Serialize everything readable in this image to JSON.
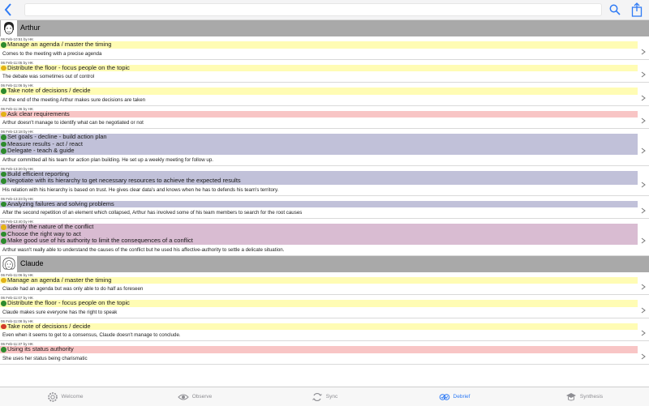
{
  "search": {
    "placeholder": "",
    "value": ""
  },
  "icons": {
    "back": "chevron-left-icon",
    "search": "search-icon",
    "share": "share-icon"
  },
  "colors": {
    "accent": "#2f7bf5",
    "yellow": "#fffcb4",
    "red": "#f8c5c5",
    "lavender": "#c1c1d9",
    "purple": "#d9bcd2",
    "status_ok": "#2e8b2e",
    "status_mid": "#e3b317",
    "status_bad": "#d23a2a"
  },
  "people": [
    {
      "name": "Arthur",
      "entries": [
        {
          "meta": "06 Feb-10:51 by HK",
          "color": "yellow",
          "criteria": [
            {
              "status": "ok",
              "label": "Manage an agenda / master the timing"
            }
          ],
          "comment": "Comes to the meeting with a precise agenda"
        },
        {
          "meta": "06 Feb-11:05 by HK",
          "color": "yellow",
          "criteria": [
            {
              "status": "mid",
              "label": "Distribute the floor - focus people on the topic"
            }
          ],
          "comment": "The debate was sometimes out of control"
        },
        {
          "meta": "06 Feb-11:06 by HK",
          "color": "yellow",
          "criteria": [
            {
              "status": "ok",
              "label": "Take note of decisions / decide"
            }
          ],
          "comment": "At the end of the meeting Arthur makes sure decisions are taken"
        },
        {
          "meta": "06 Feb-11:36 by HK",
          "color": "red",
          "criteria": [
            {
              "status": "mid",
              "label": "Ask clear requirements"
            }
          ],
          "comment": "Arthur doesn't manage to identify what can be negotiated or not"
        },
        {
          "meta": "06 Feb-13:18 by HK",
          "color": "lav",
          "criteria": [
            {
              "status": "ok",
              "label": "Set goals - decline - build action plan"
            },
            {
              "status": "ok",
              "label": "Measure results - act / react"
            },
            {
              "status": "ok",
              "label": "Delegate - teach & guide"
            }
          ],
          "comment": "Arthur committed all his team for action plan building. He set up a weekly meeting for follow up."
        },
        {
          "meta": "06 Feb-13:20 by HK",
          "color": "lav",
          "criteria": [
            {
              "status": "ok",
              "label": "Build efficient reporting"
            },
            {
              "status": "ok",
              "label": "Negotiate with its hierarchy to get necessary resources to achieve the expected results"
            }
          ],
          "comment": "His relation with his hierarchy is based on trust. He gives clear data's and knows when he has to defends his team's territory."
        },
        {
          "meta": "06 Feb-13:23 by HK",
          "color": "lav",
          "criteria": [
            {
              "status": "ok",
              "label": "Analyzing failures and solving problems"
            }
          ],
          "comment": "After the second repetition of an element which collapsed, Arthur has involved some of his team members to search for the root causes"
        },
        {
          "meta": "06 Feb-13:40 by HK",
          "color": "purple",
          "criteria": [
            {
              "status": "mid",
              "label": "Identify the nature of the conflict"
            },
            {
              "status": "ok",
              "label": "Choose the right way to act"
            },
            {
              "status": "ok",
              "label": "Make good use of his authority to limit the consequences of a conflict"
            }
          ],
          "comment": "Arthur wasn't really able to understand the causes of the conflict but he used his affective-authority to settle a delicate situation."
        }
      ]
    },
    {
      "name": "Claude",
      "entries": [
        {
          "meta": "06 Feb-11:06 by HK",
          "color": "yellow",
          "criteria": [
            {
              "status": "mid",
              "label": "Manage an agenda / master the timing"
            }
          ],
          "comment": "Claude had an agenda but was only able to do half as foreseen"
        },
        {
          "meta": "06 Feb-11:07 by HK",
          "color": "yellow",
          "criteria": [
            {
              "status": "ok",
              "label": "Distribute the floor - focus people on the topic"
            }
          ],
          "comment": "Claude makes sure everyone has the right to speak"
        },
        {
          "meta": "06 Feb-11:08 by HK",
          "color": "yellow",
          "criteria": [
            {
              "status": "bad",
              "label": "Take note of decisions / decide"
            }
          ],
          "comment": "Even when it seems to get to a consensus, Claude doesn't manage to conclude."
        },
        {
          "meta": "06 Feb-11:37 by HK",
          "color": "red",
          "criteria": [
            {
              "status": "ok",
              "label": "Using its status authority"
            }
          ],
          "comment": "She uses her status being charismatic"
        }
      ]
    }
  ],
  "tabs": [
    {
      "label": "Welcome",
      "icon": "gear-icon",
      "active": false
    },
    {
      "label": "Observe",
      "icon": "eye-icon",
      "active": false
    },
    {
      "label": "Sync",
      "icon": "sync-icon",
      "active": false
    },
    {
      "label": "Debrief",
      "icon": "debrief-icon",
      "active": true
    },
    {
      "label": "Synthesis",
      "icon": "graduation-cap-icon",
      "active": false
    }
  ]
}
